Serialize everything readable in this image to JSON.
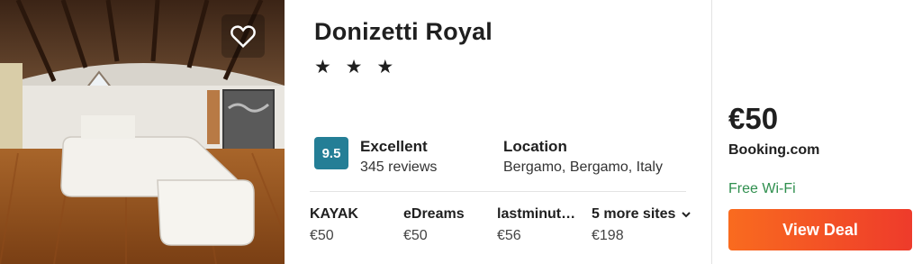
{
  "hotel": {
    "name": "Donizetti Royal",
    "stars_text": "★ ★ ★",
    "score": "9.5",
    "rating_label": "Excellent",
    "reviews": "345 reviews",
    "location_label": "Location",
    "location": "Bergamo, Bergamo, Italy"
  },
  "providers": [
    {
      "name": "KAYAK",
      "price": "€50"
    },
    {
      "name": "eDreams",
      "price": "€50"
    },
    {
      "name": "lastminut…",
      "price": "€56"
    },
    {
      "name": "5 more sites",
      "price": "€198"
    }
  ],
  "deal": {
    "price": "€50",
    "site": "Booking.com",
    "amenity": "Free Wi-Fi",
    "button_label": "View Deal"
  },
  "icons": {
    "favorite": "heart-icon",
    "expand": "chevron-down-icon"
  },
  "colors": {
    "score_badge": "#247e96",
    "deal_button": "#f4502a",
    "amenity": "#2f8f4e"
  }
}
